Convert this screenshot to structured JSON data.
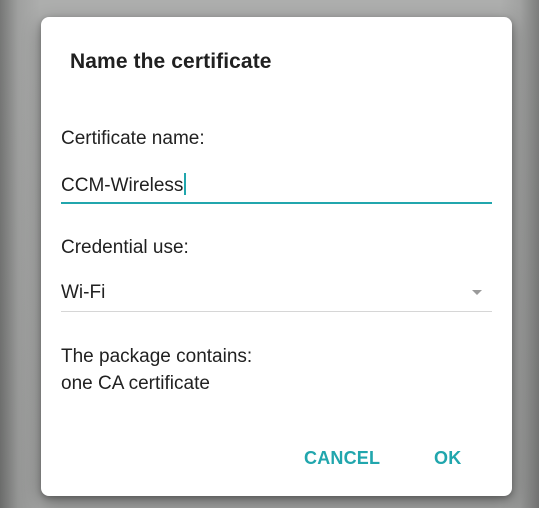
{
  "dialog": {
    "title": "Name the certificate",
    "certificate_name_label": "Certificate name:",
    "certificate_name_value": "CCM-Wireless",
    "credential_use_label": "Credential use:",
    "credential_use_value": "Wi-Fi",
    "package_line_1": "The package contains:",
    "package_line_2": "one CA certificate",
    "cancel_label": "CANCEL",
    "ok_label": "OK"
  },
  "colors": {
    "accent": "#21a6ad",
    "text": "#212121",
    "dialog_background": "#ffffff",
    "scrim": "#9a9b9a"
  },
  "icons": {
    "dropdown": "chevron-down-icon"
  }
}
